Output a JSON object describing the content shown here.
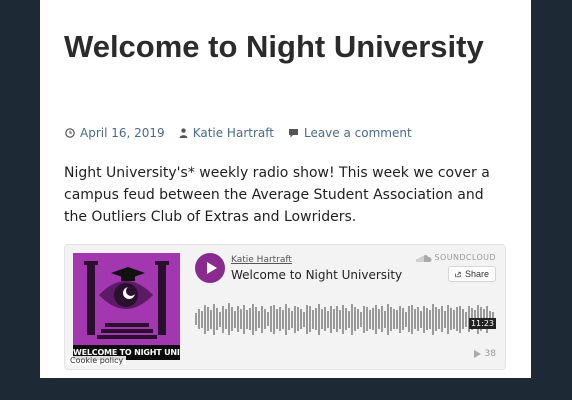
{
  "post": {
    "title": "Welcome to Night University",
    "date": "April 16, 2019",
    "author": "Katie Hartraft",
    "comment_link": "Leave a comment",
    "excerpt": "Night University's* weekly radio show! This week we cover a campus feud between the Average Student Association and the Outliers Club of Extras and Lowriders."
  },
  "player": {
    "artist": "Katie Hartraft",
    "track_title": "Welcome to Night University",
    "brand": "SOUNDCLOUD",
    "share_label": "Share",
    "duration": "11:23",
    "play_count": "38",
    "artwork_caption": "WELCOME TO NIGHT UNIVERSITY",
    "cookie_policy": "Cookie policy",
    "accent_color": "#8a2a8f",
    "artwork_color": "#a237b0",
    "waveform": [
      0.35,
      0.6,
      0.5,
      0.85,
      0.7,
      0.55,
      0.9,
      0.65,
      0.45,
      0.8,
      0.6,
      0.95,
      0.7,
      0.5,
      0.75,
      0.6,
      0.85,
      0.55,
      0.65,
      0.9,
      0.7,
      0.5,
      0.8,
      0.6,
      0.4,
      0.75,
      0.85,
      0.6,
      0.7,
      0.55,
      0.9,
      0.65,
      0.5,
      0.8,
      0.7,
      0.6,
      0.45,
      0.85,
      0.75,
      0.55,
      0.65,
      0.9,
      0.6,
      0.7,
      0.5,
      0.8,
      0.6,
      0.75,
      0.55,
      0.85,
      0.65,
      0.5,
      0.9,
      0.7,
      0.6,
      0.45,
      0.8,
      0.7,
      0.55,
      0.65,
      0.85,
      0.6,
      0.75,
      0.5,
      0.9,
      0.7,
      0.6,
      0.55,
      0.8,
      0.65,
      0.45,
      0.75,
      0.85,
      0.6,
      0.7,
      0.5,
      0.8,
      0.65,
      0.55,
      0.9,
      0.7,
      0.6,
      0.75,
      0.5,
      0.85,
      0.65,
      0.55,
      0.7,
      0.8,
      0.6,
      0.45,
      0.75,
      0.65,
      0.55,
      0.85,
      0.7,
      0.6,
      0.8,
      0.5,
      0.4
    ]
  }
}
